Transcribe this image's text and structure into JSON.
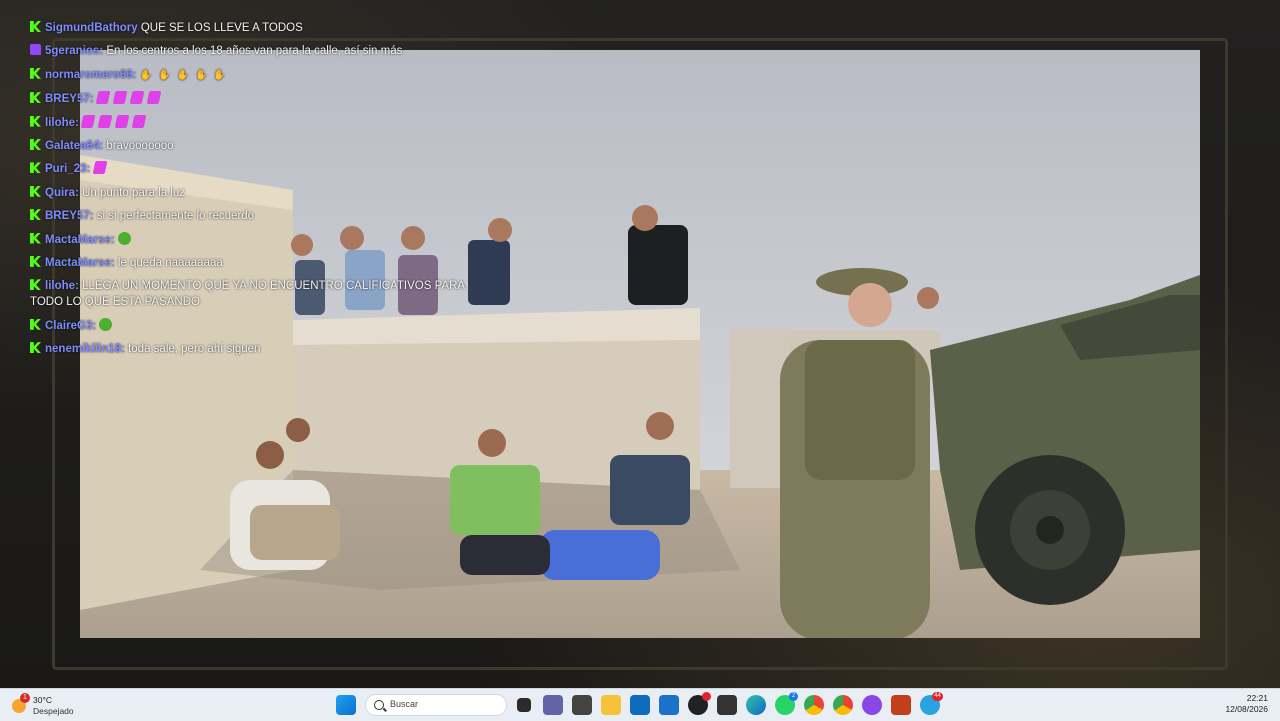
{
  "chat": [
    {
      "badge": "kick",
      "user": "SigmundBathory",
      "text": "QUE SE LOS LLEVE A TODOS",
      "emotes": null
    },
    {
      "badge": "twitch",
      "user": "5geranios:",
      "text": "En los centros a los 18 años van para la calle, así sin más",
      "emotes": null
    },
    {
      "badge": "kick",
      "user": "normaromero66:",
      "text": "",
      "emotes": "hands"
    },
    {
      "badge": "kick",
      "user": "BREY57:",
      "text": "",
      "emotes": "pink4"
    },
    {
      "badge": "kick",
      "user": "lilohe:",
      "text": "",
      "emotes": "pink4"
    },
    {
      "badge": "kick",
      "user": "Galatea64:",
      "text": "bravooooooo",
      "emotes": null
    },
    {
      "badge": "kick",
      "user": "Puri_23:",
      "text": "",
      "emotes": "pink1"
    },
    {
      "badge": "kick",
      "user": "Quira:",
      "text": "Un punto para la luz",
      "emotes": null
    },
    {
      "badge": "kick",
      "user": "BREY57:",
      "text": "si si perfectamente lo recuerdo",
      "emotes": null
    },
    {
      "badge": "kick",
      "user": "MactaMarse:",
      "text": "",
      "emotes": "green"
    },
    {
      "badge": "kick",
      "user": "MactaMarse:",
      "text": "le queda naaaaaaaa",
      "emotes": null
    },
    {
      "badge": "kick",
      "user": "lilohe:",
      "text": "LLEGA UN MOMENTO QUE YA NO ENCUENTRO CALIFICATIVOS PARA TODO LO QUE ESTA PASANDO",
      "emotes": null
    },
    {
      "badge": "kick",
      "user": "ClaireG3:",
      "text": "",
      "emotes": "green"
    },
    {
      "badge": "kick",
      "user": "nenemikilin18:",
      "text": "toda sale, pero ahí siguen",
      "emotes": null
    }
  ],
  "taskbar": {
    "weather_alert": "1",
    "temperature": "30°C",
    "condition": "Despejado",
    "search_placeholder": "Buscar",
    "time": "22:21",
    "date": "12/08/2026",
    "badges": {
      "whatsapp": "2",
      "telegram": "44"
    }
  },
  "colors": {
    "kick": "#53fc18",
    "twitch": "#9146ff",
    "username": "#7e8cff"
  }
}
